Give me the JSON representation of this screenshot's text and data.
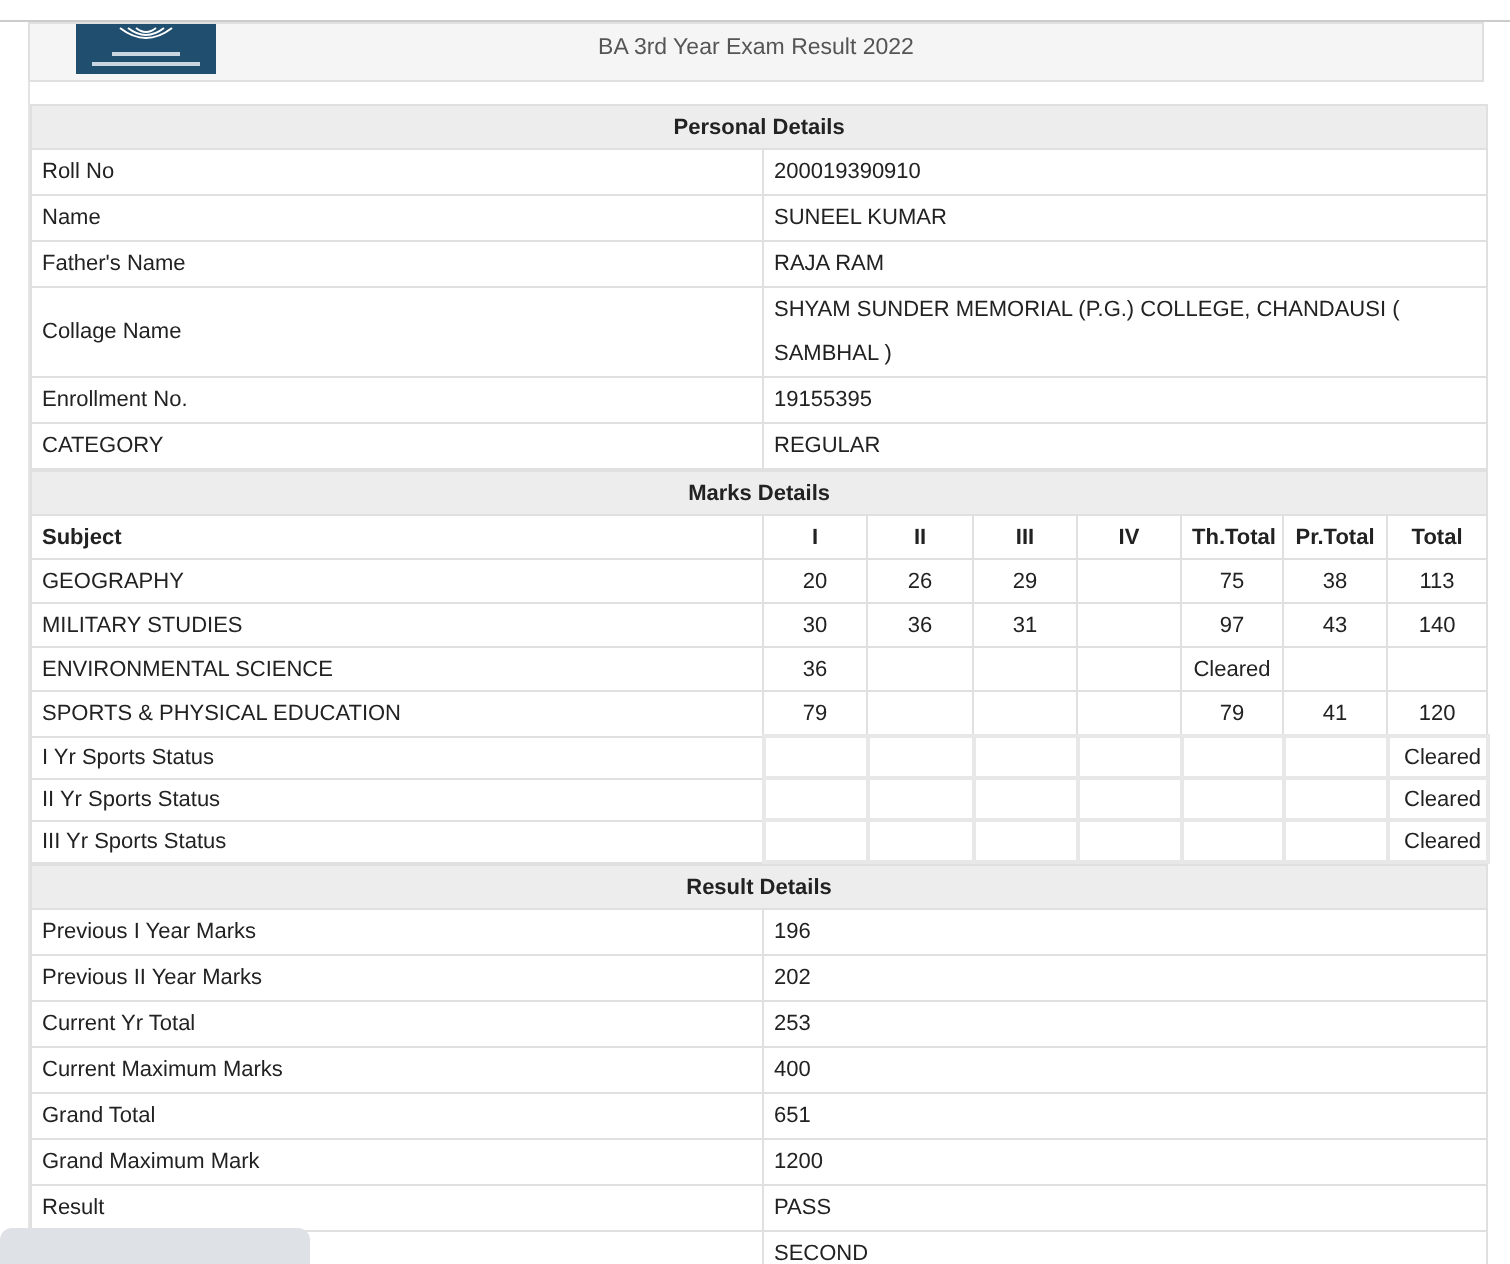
{
  "header": {
    "title": "BA 3rd Year Exam Result 2022"
  },
  "personal": {
    "heading": "Personal Details",
    "rows": [
      {
        "label": "Roll No",
        "value": "200019390910"
      },
      {
        "label": "Name",
        "value": "SUNEEL KUMAR"
      },
      {
        "label": "Father's Name",
        "value": "RAJA RAM"
      },
      {
        "label": "Collage Name",
        "value": "SHYAM SUNDER MEMORIAL (P.G.) COLLEGE, CHANDAUSI ( SAMBHAL )"
      },
      {
        "label": "Enrollment No.",
        "value": "19155395"
      },
      {
        "label": "CATEGORY",
        "value": "REGULAR"
      }
    ]
  },
  "marks": {
    "heading": "Marks Details",
    "columns": [
      "Subject",
      "I",
      "II",
      "III",
      "IV",
      "Th.Total",
      "Pr.Total",
      "Total"
    ],
    "rows": [
      {
        "kind": "subject",
        "cells": [
          "GEOGRAPHY",
          "20",
          "26",
          "29",
          "",
          "75",
          "38",
          "113"
        ]
      },
      {
        "kind": "subject",
        "cells": [
          "MILITARY STUDIES",
          "30",
          "36",
          "31",
          "",
          "97",
          "43",
          "140"
        ]
      },
      {
        "kind": "subject",
        "cells": [
          "ENVIRONMENTAL SCIENCE",
          "36",
          "",
          "",
          "",
          "Cleared",
          "",
          ""
        ]
      },
      {
        "kind": "subject",
        "cells": [
          "SPORTS & PHYSICAL EDUCATION",
          "79",
          "",
          "",
          "",
          "79",
          "41",
          "120"
        ]
      },
      {
        "kind": "status",
        "label": "I Yr Sports Status",
        "status": "Cleared"
      },
      {
        "kind": "status",
        "label": "II Yr Sports Status",
        "status": "Cleared"
      },
      {
        "kind": "status",
        "label": "III Yr Sports Status",
        "status": "Cleared"
      }
    ]
  },
  "result": {
    "heading": "Result Details",
    "rows": [
      {
        "label": "Previous I Year Marks",
        "value": "196"
      },
      {
        "label": "Previous II Year Marks",
        "value": "202"
      },
      {
        "label": "Current Yr Total",
        "value": "253"
      },
      {
        "label": "Current Maximum Marks",
        "value": "400"
      },
      {
        "label": "Grand Total",
        "value": "651"
      },
      {
        "label": "Grand Maximum Mark",
        "value": "1200"
      },
      {
        "label": "Result",
        "value": "PASS"
      },
      {
        "value": "SECOND"
      }
    ]
  }
}
